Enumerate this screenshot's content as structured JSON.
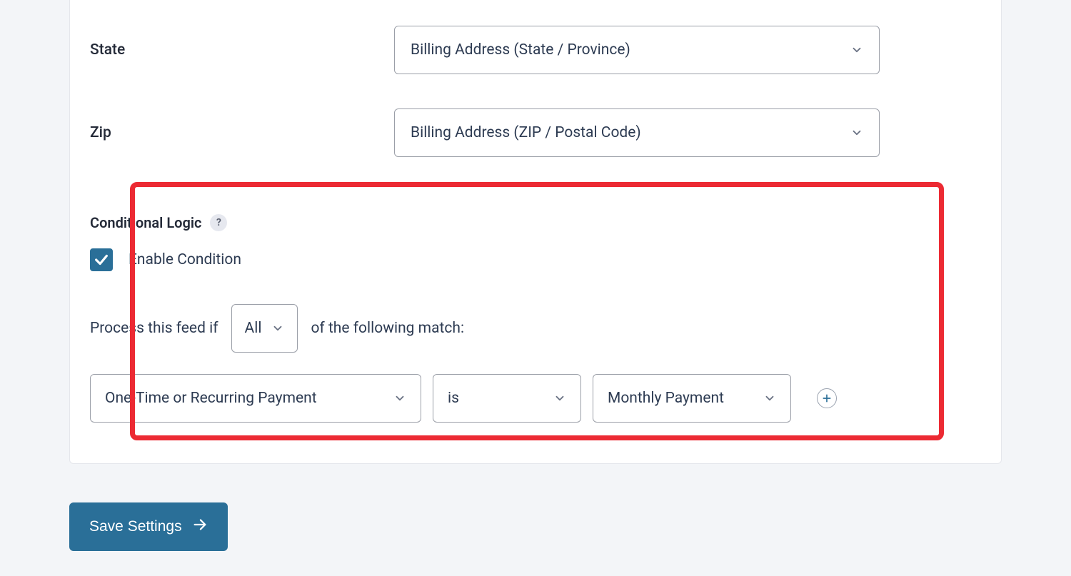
{
  "fields": {
    "state": {
      "label": "State",
      "value": "Billing Address (State / Province)"
    },
    "zip": {
      "label": "Zip",
      "value": "Billing Address (ZIP / Postal Code)"
    }
  },
  "conditional": {
    "heading": "Conditional Logic",
    "help": "?",
    "enable_label": "Enable Condition",
    "enabled": true,
    "prefix": "Process this feed if",
    "match_type": "All",
    "suffix": "of the following match:",
    "row": {
      "field": "One-Time or Recurring Payment",
      "operator": "is",
      "value": "Monthly Payment"
    }
  },
  "buttons": {
    "save": "Save Settings"
  }
}
